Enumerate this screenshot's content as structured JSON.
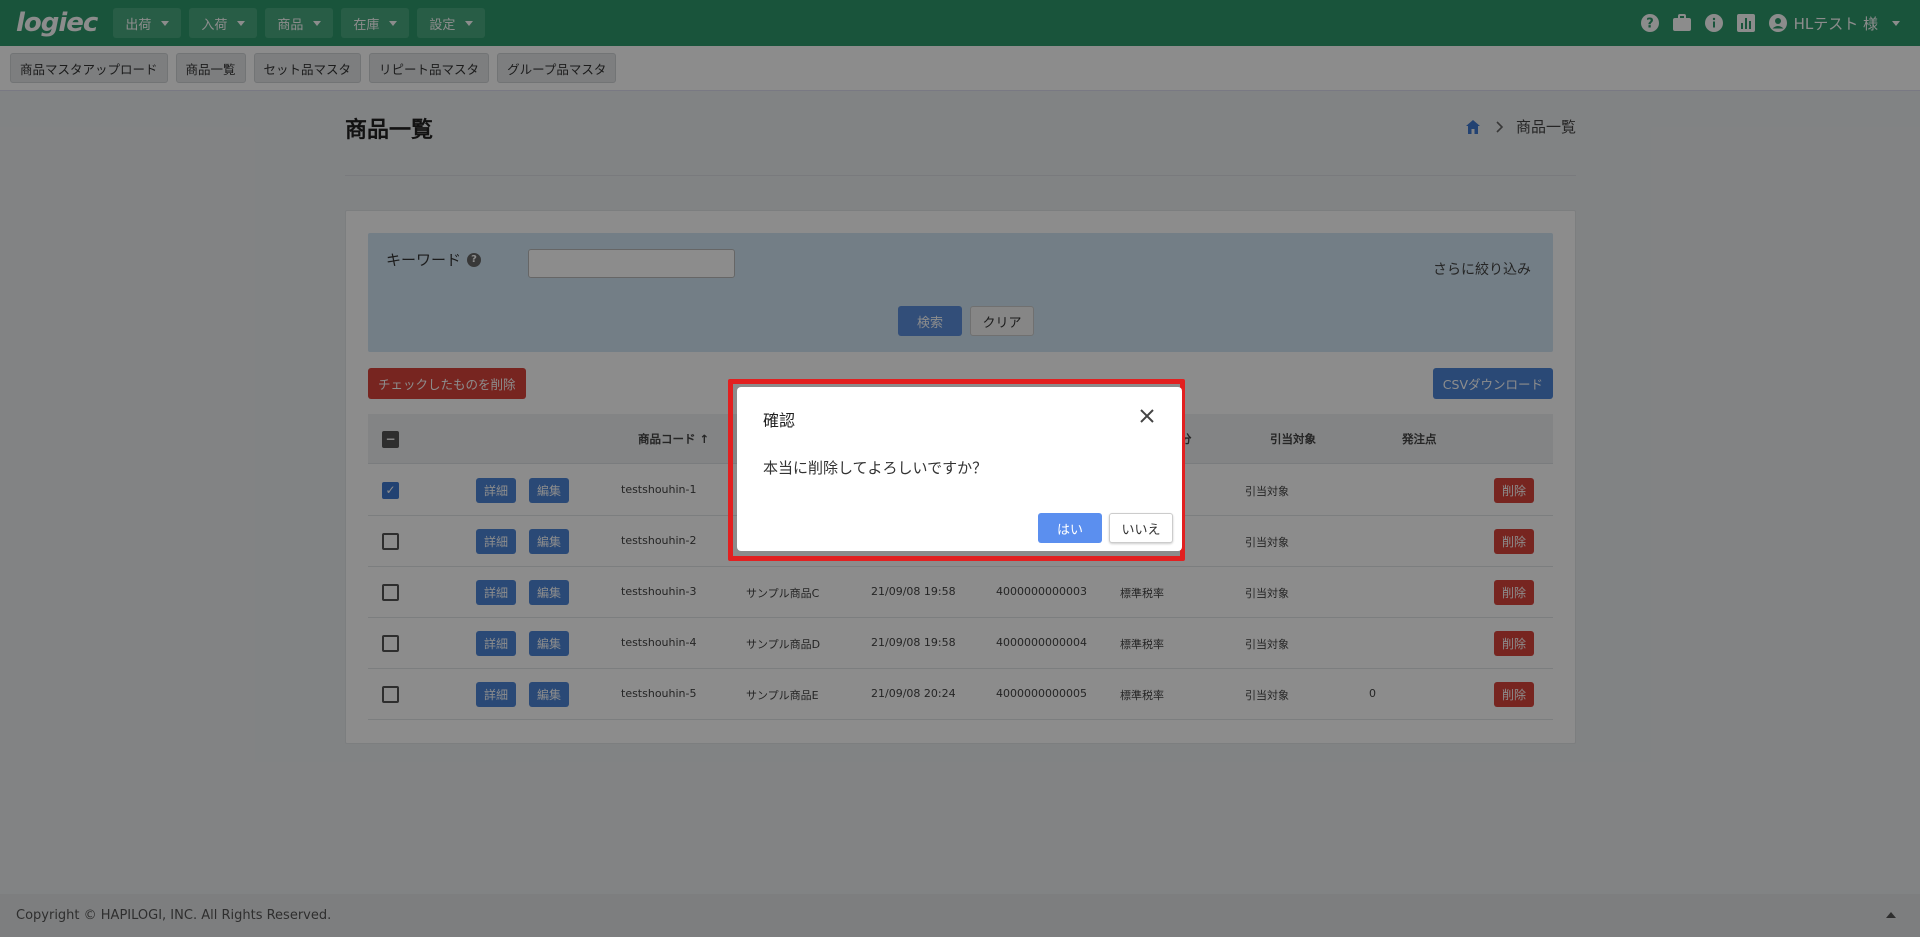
{
  "app": {
    "logo": "logiec",
    "nav": [
      "出荷",
      "入荷",
      "商品",
      "在庫",
      "設定"
    ],
    "user": "HLテスト 様"
  },
  "subnav": [
    "商品マスタアップロード",
    "商品一覧",
    "セット品マスタ",
    "リピート品マスタ",
    "グループ品マスタ"
  ],
  "page": {
    "title": "商品一覧",
    "breadcrumb": "商品一覧"
  },
  "search": {
    "keyword_label": "キーワード",
    "keyword_value": "",
    "refine_link": "さらに絞り込み",
    "search_button": "検索",
    "clear_button": "クリア"
  },
  "actions": {
    "bulk_delete": "チェックしたものを削除",
    "csv_download": "CSVダウンロード"
  },
  "table": {
    "headers": {
      "code": "商品コード ↑",
      "tax": "分",
      "allocation": "引当対象",
      "reorder": "発注点"
    },
    "detail_label": "詳細",
    "edit_label": "編集",
    "delete_label": "削除",
    "rows": [
      {
        "checked": true,
        "code": "testshouhin-1",
        "name": "",
        "date": "",
        "jan": "",
        "tax": "",
        "allocation": "引当対象",
        "reorder": ""
      },
      {
        "checked": false,
        "code": "testshouhin-2",
        "name": "",
        "date": "",
        "jan": "",
        "tax": "",
        "allocation": "引当対象",
        "reorder": ""
      },
      {
        "checked": false,
        "code": "testshouhin-3",
        "name": "サンプル商品C",
        "date": "21/09/08 19:58",
        "jan": "4000000000003",
        "tax": "標準税率",
        "allocation": "引当対象",
        "reorder": ""
      },
      {
        "checked": false,
        "code": "testshouhin-4",
        "name": "サンプル商品D",
        "date": "21/09/08 19:58",
        "jan": "4000000000004",
        "tax": "標準税率",
        "allocation": "引当対象",
        "reorder": ""
      },
      {
        "checked": false,
        "code": "testshouhin-5",
        "name": "サンプル商品E",
        "date": "21/09/08 20:24",
        "jan": "4000000000005",
        "tax": "標準税率",
        "allocation": "引当対象",
        "reorder": "0"
      }
    ]
  },
  "dialog": {
    "title": "確認",
    "message": "本当に削除してよろしいですか？",
    "yes": "はい",
    "no": "いいえ"
  },
  "footer": "Copyright © HAPILOGI, INC. All Rights Reserved.",
  "colors": {
    "topbar": "#2f9a6c",
    "primary": "#4e86d8",
    "danger": "#d9443b",
    "highlight": "#e22020"
  }
}
